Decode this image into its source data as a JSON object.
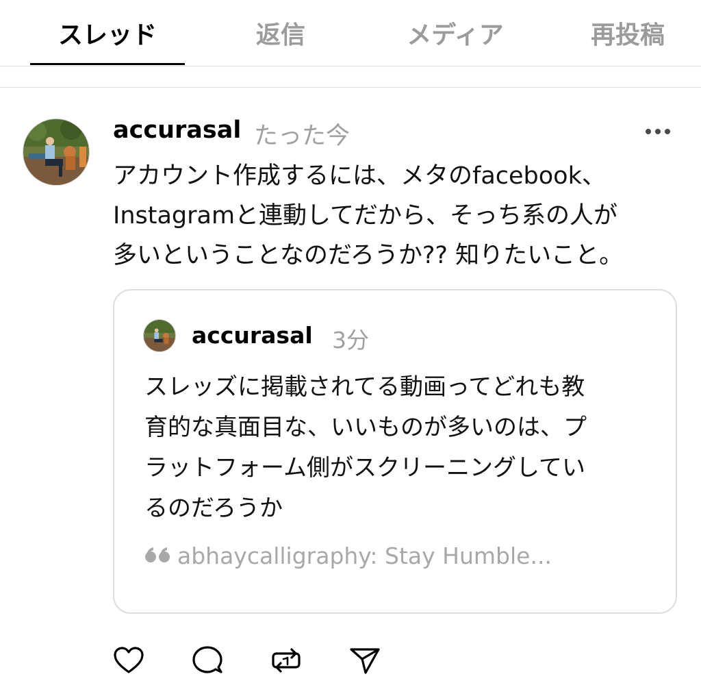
{
  "tabs": [
    {
      "label": "スレッド",
      "active": true
    },
    {
      "label": "返信",
      "active": false
    },
    {
      "label": "メディア",
      "active": false
    },
    {
      "label": "再投稿",
      "active": false
    }
  ],
  "post": {
    "username": "accurasal",
    "timestamp": "たった今",
    "more_icon": "more-horizontal-icon",
    "text_lines": [
      "アカウント作成するには、メタのfacebook、",
      "Instagramと連動してだから、そっち系の人が",
      "多いということなのだろうか?? 知りたいこと。"
    ],
    "quote": {
      "username": "accurasal",
      "timestamp": "3分",
      "text_lines": [
        "スレッズに掲載されてる動画ってどれも教",
        "育的な真面目な、いいものが多いのは、プ",
        "ラットフォーム側がスクリーニングしてい",
        "るのだろうか"
      ],
      "attribution": "abhaycalligraphy: Stay Humble..."
    },
    "actions": {
      "like_icon": "heart-icon",
      "comment_icon": "comment-icon",
      "repost_icon": "repost-icon",
      "share_icon": "send-icon"
    }
  },
  "colors": {
    "text_primary": "#000000",
    "text_secondary": "#9b9b9b",
    "border": "#dddddd"
  }
}
